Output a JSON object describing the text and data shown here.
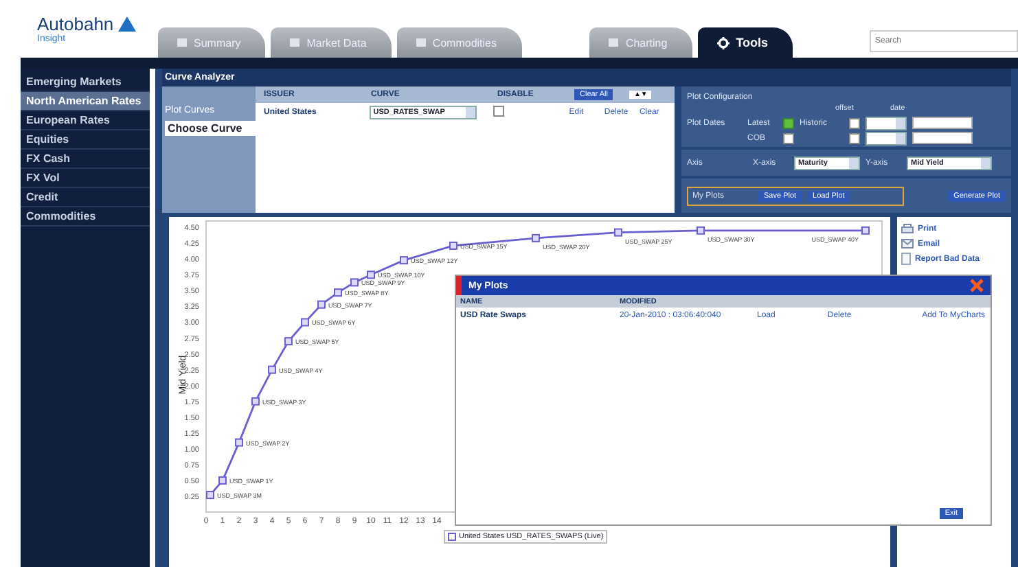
{
  "header": {
    "logo": "Autobahn",
    "logo_sub": "Insight",
    "search": {
      "placeholder": "Search"
    },
    "tabs": [
      {
        "label": "Summary",
        "selected": false,
        "kind": "main"
      },
      {
        "label": "Market Data",
        "selected": false,
        "kind": "main"
      },
      {
        "label": "Commodities",
        "selected": false,
        "kind": "main"
      },
      {
        "label": "Charting",
        "selected": false,
        "kind": "tool"
      },
      {
        "label": "Tools",
        "selected": true,
        "kind": "tool"
      }
    ]
  },
  "sidebar": {
    "items": [
      {
        "label": "Emerging Markets",
        "selected": false
      },
      {
        "label": "North American Rates",
        "selected": true
      },
      {
        "label": "European Rates",
        "selected": false
      },
      {
        "label": "Equities",
        "selected": false
      },
      {
        "label": "FX Cash",
        "selected": false
      },
      {
        "label": "FX Vol",
        "selected": false
      },
      {
        "label": "Credit",
        "selected": false
      },
      {
        "label": "Commodities",
        "selected": false
      }
    ]
  },
  "panel": {
    "title": "Curve Analyzer",
    "plot_curves": {
      "label": "Plot Curves",
      "choose": "Choose Curve",
      "columns": [
        "ISSUER",
        "CURVE",
        "DISABLE"
      ],
      "clear_all": "Clear All",
      "sort": "▲▼",
      "rows": [
        {
          "issuer": "United States",
          "curve": "USD_RATES_SWAP",
          "disabled": false,
          "actions": [
            "Edit",
            "Delete",
            "Clear"
          ]
        }
      ]
    },
    "plot_config": {
      "title": "Plot Configuration",
      "dates_label": "Plot Dates",
      "offset_label": "offset",
      "date_label": "date",
      "rows": [
        {
          "label": "Latest",
          "checked": true,
          "hist_label": "Historic",
          "hist_checked": false
        },
        {
          "label": "COB",
          "checked": false,
          "hist_checked": false
        }
      ],
      "axis_label": "Axis",
      "x_axis_label": "X-axis",
      "x_axis": "Maturity",
      "y_axis_label": "Y-axis",
      "y_axis": "Mid Yield",
      "my_plots_label": "My Plots",
      "buttons": [
        "Save Plot",
        "Load Plot"
      ],
      "generate": "Generate Plot"
    }
  },
  "chart": {
    "chart_data": {
      "type": "line",
      "ylabel": "Mid Yield",
      "xlim": [
        0,
        41
      ],
      "ylim": [
        0,
        4.6
      ],
      "xticks": [
        0,
        1,
        2,
        3,
        4,
        5,
        6,
        7,
        8,
        9,
        10,
        11,
        12,
        13,
        14
      ],
      "yticks": [
        {
          "value": 0.25,
          "label": "0.25"
        },
        {
          "value": 0.5,
          "label": "0.50"
        },
        {
          "value": 0.75,
          "label": "0.75"
        },
        {
          "value": 1,
          "label": "1.00"
        },
        {
          "value": 1.25,
          "label": "1.25"
        },
        {
          "value": 1.5,
          "label": "1.50"
        },
        {
          "value": 1.75,
          "label": "1.75"
        },
        {
          "value": 2,
          "label": "2.00"
        },
        {
          "value": 2.25,
          "label": "2.25"
        },
        {
          "value": 2.5,
          "label": "2.50"
        },
        {
          "value": 2.75,
          "label": "2.75"
        },
        {
          "value": 3,
          "label": "3.00"
        },
        {
          "value": 3.25,
          "label": "3.25"
        },
        {
          "value": 3.5,
          "label": "3.50"
        },
        {
          "value": 3.75,
          "label": "3.75"
        },
        {
          "value": 4,
          "label": "4.00"
        },
        {
          "value": 4.25,
          "label": "4.25"
        },
        {
          "value": 4.5,
          "label": "4.50"
        }
      ],
      "x": [
        0.25,
        1,
        2,
        3,
        4,
        5,
        6,
        7,
        8,
        9,
        10,
        12,
        15,
        20,
        25,
        30,
        40
      ],
      "series": [
        {
          "name": "United States USD_RATES_SWAPS (Live)",
          "color": "#6a5fd0",
          "marker": "square",
          "values": [
            0.27,
            0.5,
            1.1,
            1.75,
            2.25,
            2.7,
            3.0,
            3.28,
            3.47,
            3.63,
            3.75,
            3.98,
            4.21,
            4.33,
            4.42,
            4.45,
            4.45
          ]
        }
      ],
      "annotations": [
        "USD_SWAP 3M",
        "USD_SWAP 1Y",
        "USD_SWAP 2Y",
        "USD_SWAP 3Y",
        "USD_SWAP 4Y",
        "USD_SWAP 5Y",
        "USD_SWAP 6Y",
        "USD_SWAP 7Y",
        "USD_SWAP 8Y",
        "USD_SWAP 9Y",
        "USD_SWAP 10Y",
        "USD_SWAP 12Y",
        "USD_SWAP 15Y",
        "USD_SWAP 20Y",
        "USD_SWAP 25Y",
        "USD_SWAP 30Y",
        "USD_SWAP 40Y"
      ]
    }
  },
  "actions": [
    {
      "label": "Print",
      "kind": "print"
    },
    {
      "label": "Email",
      "kind": "email"
    },
    {
      "label": "Report Bad Data",
      "kind": "report"
    }
  ],
  "dialog": {
    "title": "My Plots",
    "columns": [
      "NAME",
      "MODIFIED"
    ],
    "rows": [
      {
        "name": "USD Rate Swaps",
        "modified": "20-Jan-2010 : 03:06:40:040",
        "actions": [
          "Load",
          "Delete",
          "Add To MyCharts"
        ]
      }
    ],
    "button": "Exit"
  }
}
